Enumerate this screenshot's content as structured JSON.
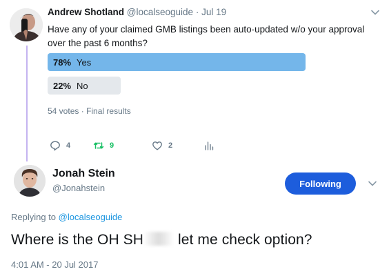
{
  "parent_tweet": {
    "author_name": "Andrew Shotland",
    "handle": "@localseoguide",
    "separator": "·",
    "date": "Jul 19",
    "text": "Have any of your claimed GMB listings been auto-updated w/o your approval over the past 6 months?",
    "poll": {
      "options": [
        {
          "percent": "78%",
          "label": "Yes",
          "fraction": 0.78,
          "leading": true
        },
        {
          "percent": "22%",
          "label": "No",
          "fraction": 0.22,
          "leading": false
        }
      ],
      "votes": "54 votes",
      "separator": "·",
      "status": "Final results"
    },
    "actions": {
      "reply_count": "4",
      "retweet_count": "9",
      "like_count": "2"
    }
  },
  "main_tweet": {
    "author_name": "Jonah Stein",
    "handle": "@Jonahstein",
    "follow_label": "Following",
    "replying_to_prefix": "Replying to",
    "replying_to_handle": "@localseoguide",
    "text_before": "Where is the OH SH",
    "text_after": "let me check option?",
    "timestamp": "4:01 AM - 20 Jul 2017"
  },
  "colors": {
    "accent_blue": "#1d5ddc",
    "poll_leading": "#74b6ea",
    "poll_other": "#e4e8ec",
    "retweet_green": "#17bf63",
    "muted_text": "#657786",
    "thread_line": "#c4b3f0"
  },
  "icons": {
    "reply": "reply-icon",
    "retweet": "retweet-icon",
    "like": "heart-icon",
    "analytics": "analytics-icon",
    "menu": "chevron-down-icon"
  }
}
